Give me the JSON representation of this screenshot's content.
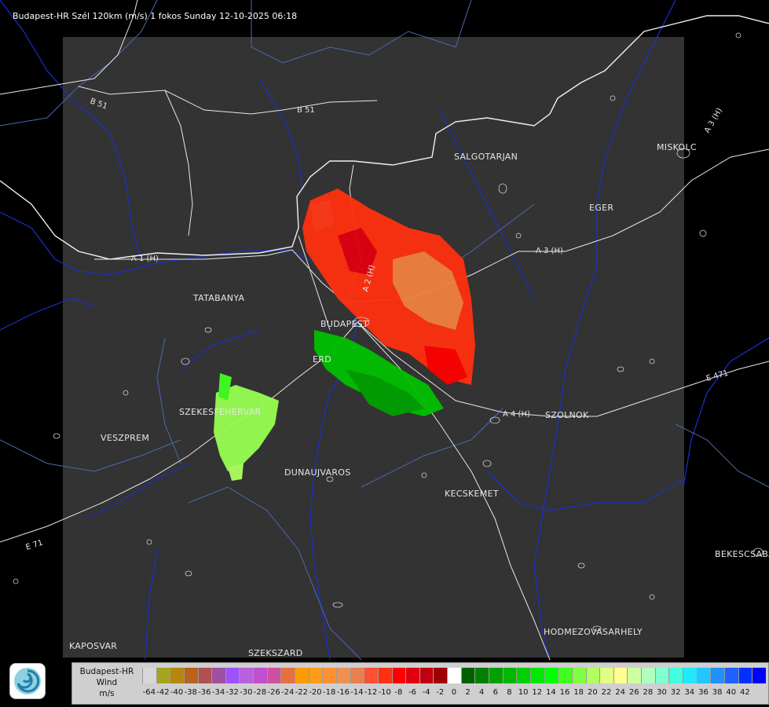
{
  "title": "Budapest-HR Szél 120km (m/s) 1 fokos Sunday 12-10-2025 06:18",
  "map": {
    "cities": [
      "SALGOTARJAN",
      "EGER",
      "MISKOLC",
      "TATABANYA",
      "BUDAPEST",
      "ERD",
      "SZEKESFEHERVAR",
      "VESZPREM",
      "DUNAUJVAROS",
      "KECSKEMET",
      "SZOLNOK",
      "BEKESCSABA",
      "HODMEZOVASARHELY",
      "KAPOSVAR",
      "SZEKSZARD"
    ],
    "roads": [
      "B 51",
      "B 51",
      "A 1 (H)",
      "A 3 (H)",
      "A 3 (H)",
      "A 2 (H)",
      "A 4 (H)",
      "E 71",
      "E 471"
    ]
  },
  "legend": {
    "heading": [
      "Budapest-HR",
      "Wind",
      "m/s"
    ],
    "colors": [
      "#d7d7d7",
      "#a5a51b",
      "#b8860b",
      "#b8621b",
      "#b05050",
      "#a050a0",
      "#a050ff",
      "#b860e0",
      "#c050d0",
      "#d050a0",
      "#e87040",
      "#ff9a00",
      "#ff9a1a",
      "#ff9030",
      "#f09050",
      "#e88050",
      "#ff5030",
      "#ff3010",
      "#ff0000",
      "#e00010",
      "#c00010",
      "#a00000",
      "#ffffff",
      "#006000",
      "#008000",
      "#00a000",
      "#00b800",
      "#00d000",
      "#00e800",
      "#00ff00",
      "#40ff20",
      "#80ff40",
      "#b0ff60",
      "#e0ff80",
      "#ffff90",
      "#d0ffa0",
      "#b0ffc0",
      "#80ffd0",
      "#40ffe0",
      "#20e8ff",
      "#20c8ff",
      "#2090ff",
      "#2060ff",
      "#0030ff",
      "#0000ff"
    ],
    "ticks": [
      "-64",
      "-42",
      "-40",
      "-38",
      "-36",
      "-34",
      "-32",
      "-30",
      "-28",
      "-26",
      "-24",
      "-22",
      "-20",
      "-18",
      "-16",
      "-14",
      "-12",
      "-10",
      "-8",
      "-6",
      "-4",
      "-2",
      "0",
      "2",
      "4",
      "6",
      "8",
      "10",
      "12",
      "14",
      "16",
      "18",
      "20",
      "22",
      "24",
      "26",
      "28",
      "30",
      "32",
      "34",
      "36",
      "38",
      "40",
      "42"
    ]
  }
}
